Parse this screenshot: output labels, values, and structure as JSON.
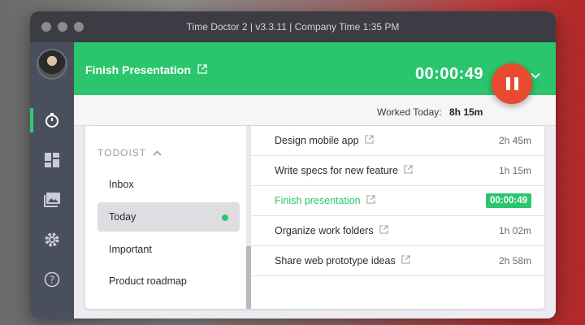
{
  "window": {
    "title": "Time Doctor 2 | v3.3.11 | Company Time 1:35 PM"
  },
  "header": {
    "task": "Finish Presentation",
    "timer": "00:00:49"
  },
  "worked": {
    "label": "Worked Today:",
    "value": "8h 15m"
  },
  "projects": {
    "heading": "TODOIST",
    "items": [
      {
        "label": "Inbox"
      },
      {
        "label": "Today"
      },
      {
        "label": "Important"
      },
      {
        "label": "Product roadmap"
      }
    ]
  },
  "tasks": [
    {
      "name": "Design mobile app",
      "time": "2h 45m"
    },
    {
      "name": "Write specs for new feature",
      "time": "1h 15m"
    },
    {
      "name": "Finish presentation",
      "time": "00:00:49"
    },
    {
      "name": "Organize work folders",
      "time": "1h 02m"
    },
    {
      "name": "Share web prototype ideas",
      "time": "2h 58m"
    }
  ],
  "colors": {
    "accent": "#2ac56c",
    "pause": "#ea4a2f",
    "sidebar": "#4a4f5e"
  },
  "icons": [
    "timer-icon",
    "dashboard-icon",
    "screenshots-icon",
    "settings-icon",
    "help-icon",
    "external-link-icon",
    "chevron-down-icon",
    "pause-icon"
  ]
}
